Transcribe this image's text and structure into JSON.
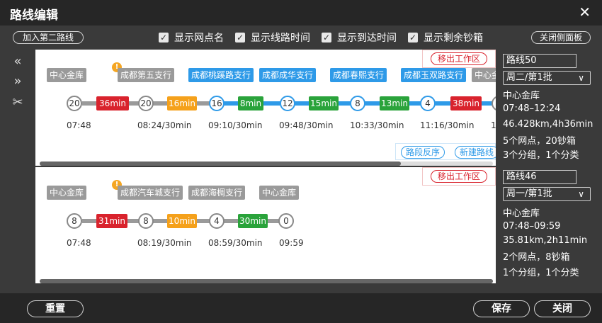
{
  "dialog": {
    "title": "路线编辑",
    "close_glyph": "✕"
  },
  "toolbar": {
    "add_second_route": "加入第二路线",
    "close_side_panel": "关闭侧面板",
    "checkboxes": [
      {
        "label": "显示网点名",
        "checked": true
      },
      {
        "label": "显示线路时间",
        "checked": true
      },
      {
        "label": "显示到达时间",
        "checked": true
      },
      {
        "label": "显示剩余钞箱",
        "checked": true
      }
    ]
  },
  "side_tools": [
    {
      "icon": "double-chevron-left-icon",
      "glyph": "«"
    },
    {
      "icon": "double-chevron-right-icon",
      "glyph": "»"
    },
    {
      "icon": "scissors-icon",
      "glyph": "✂"
    }
  ],
  "routes": [
    {
      "move_out_label": "移出工作区",
      "reverse_label": "路段反序",
      "new_route_label": "新建路线",
      "stops": [
        {
          "name": "中心金库",
          "style": "gray",
          "warn": false
        },
        {
          "name": "成都第五支行",
          "style": "gray",
          "warn": true
        },
        {
          "name": "成都桃蹊路支行",
          "style": "blue",
          "warn": false
        },
        {
          "name": "成都成华支行",
          "style": "blue",
          "warn": false
        },
        {
          "name": "成都春熙支行",
          "style": "blue",
          "warn": false
        },
        {
          "name": "成都玉双路支行",
          "style": "blue",
          "warn": false
        },
        {
          "name": "中心金",
          "style": "gray",
          "warn": false
        }
      ],
      "nodes": [
        "20",
        "20",
        "16",
        "12",
        "8",
        "4",
        ""
      ],
      "segments": [
        "36min",
        "16min",
        "8min",
        "15min",
        "13min",
        "38min"
      ],
      "times": [
        "07:48",
        "08:24/30min",
        "09:10/30min",
        "09:48/30min",
        "10:33/30min",
        "11:16/30min",
        "1"
      ],
      "info": {
        "name": "路线50",
        "schedule": "周二/第1批",
        "depot": "中心金库",
        "window": "07:48–12:24",
        "distance": "46.428km,4h36min",
        "stats": "5个网点，20钞箱",
        "groups": "3个分组，1个分类"
      }
    },
    {
      "move_out_label": "移出工作区",
      "stops": [
        {
          "name": "中心金库",
          "style": "gray",
          "warn": false
        },
        {
          "name": "成都汽车城支行",
          "style": "gray",
          "warn": true
        },
        {
          "name": "成都海椆支行",
          "style": "gray",
          "warn": false
        },
        {
          "name": "中心金库",
          "style": "gray",
          "warn": false
        }
      ],
      "nodes": [
        "8",
        "8",
        "4",
        "0"
      ],
      "segments": [
        "31min",
        "10min",
        "30min"
      ],
      "times": [
        "07:48",
        "08:19/30min",
        "08:59/30min",
        "09:59"
      ],
      "info": {
        "name": "路线46",
        "schedule": "周一/第1批",
        "depot": "中心金库",
        "window": "07:48–09:59",
        "distance": "35.81km,2h11min",
        "stats": "2个网点，8钞箱",
        "groups": "1个分组，1个分类"
      }
    }
  ],
  "footer": {
    "reset": "重置",
    "save": "保存",
    "close": "关闭"
  },
  "colors": {
    "red": "#d9232d",
    "orange": "#f5a11b",
    "green": "#2aa33b",
    "blue": "#2e9ae8",
    "gray": "#9a9a9a"
  }
}
